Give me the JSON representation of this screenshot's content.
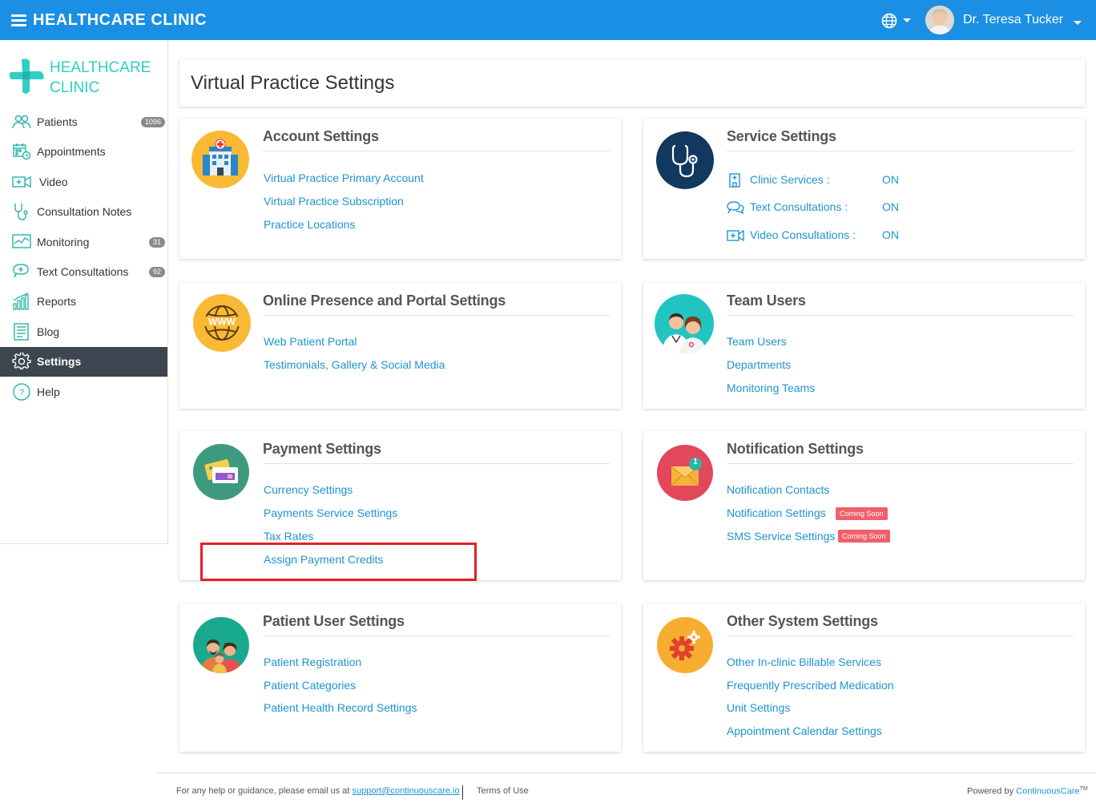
{
  "header": {
    "title": "HEALTHCARE CLINIC",
    "user_name": "Dr. Teresa Tucker",
    "color": "#1a8fe3"
  },
  "sidebar": {
    "logo_line1": "HEALTHCARE",
    "logo_line2": "CLINIC",
    "items": [
      {
        "label": "Patients",
        "icon": "patients-icon",
        "count": "1096"
      },
      {
        "label": "Appointments",
        "icon": "calendar-icon"
      },
      {
        "label": "Video",
        "icon": "video-icon"
      },
      {
        "label": "Consultation Notes",
        "icon": "stethoscope-icon"
      },
      {
        "label": "Monitoring",
        "icon": "monitoring-icon",
        "count": "31"
      },
      {
        "label": "Text Consultations",
        "icon": "chat-icon",
        "count": "92"
      },
      {
        "label": "Reports",
        "icon": "reports-icon"
      },
      {
        "label": "Blog",
        "icon": "blog-icon"
      },
      {
        "label": "Settings",
        "icon": "gear-icon",
        "active": true
      },
      {
        "label": "Help",
        "icon": "help-icon"
      }
    ]
  },
  "page": {
    "title": "Virtual Practice Settings"
  },
  "sections": {
    "account": {
      "title": "Account Settings",
      "links": [
        "Virtual Practice Primary Account",
        "Virtual Practice Subscription",
        "Practice Locations"
      ]
    },
    "service": {
      "title": "Service Settings",
      "rows": [
        {
          "label": "Clinic Services :",
          "value": "ON",
          "icon": "clinic-icon"
        },
        {
          "label": "Text Consultations :",
          "value": "ON",
          "icon": "chat-icon"
        },
        {
          "label": "Video Consultations :",
          "value": "ON",
          "icon": "video-icon"
        }
      ]
    },
    "online": {
      "title": "Online Presence and Portal Settings",
      "links": [
        "Web Patient Portal",
        "Testimonials, Gallery & Social Media"
      ]
    },
    "team": {
      "title": "Team Users",
      "links": [
        "Team Users",
        "Departments",
        "Monitoring Teams"
      ]
    },
    "payment": {
      "title": "Payment Settings",
      "links": [
        "Currency Settings",
        "Payments Service Settings",
        "Tax Rates",
        "Assign Payment Credits"
      ]
    },
    "notification": {
      "title": "Notification Settings",
      "links": [
        "Notification Contacts",
        "Notification Settings",
        "SMS Service Settings"
      ],
      "badge": "Coming Soon",
      "badge_count": "1"
    },
    "patient": {
      "title": "Patient User Settings",
      "links": [
        "Patient Registration",
        "Patient Categories",
        "Patient Health Record Settings"
      ]
    },
    "other": {
      "title": "Other System Settings",
      "links": [
        "Other In-clinic Billable Services",
        "Frequently Prescribed Medication",
        "Unit Settings",
        "Appointment Calendar Settings"
      ]
    }
  },
  "footer": {
    "help_text": "For any help or guidance, please email us at",
    "email": "support@continuouscare.io",
    "terms": "Terms of Use",
    "powered_by": "Powered by",
    "powered_brand": "ContinuousCare",
    "tm": "TM"
  }
}
